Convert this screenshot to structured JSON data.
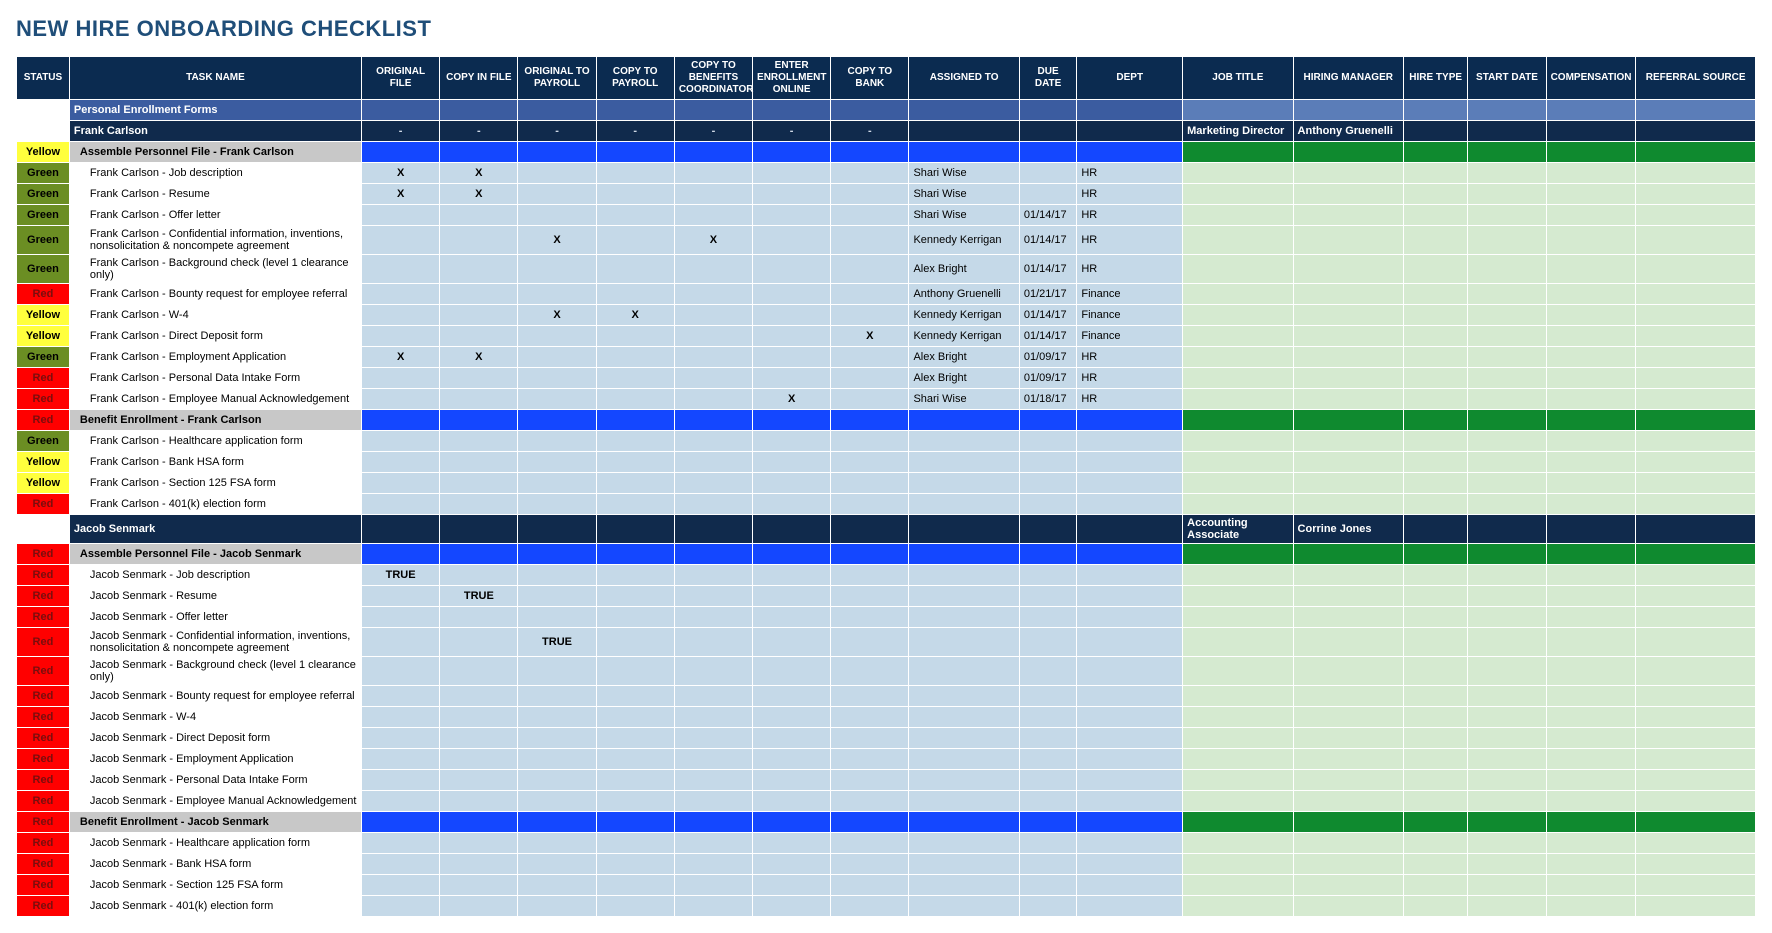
{
  "title": "NEW HIRE ONBOARDING CHECKLIST",
  "columns": [
    "STATUS",
    "TASK NAME",
    "ORIGINAL FILE",
    "COPY IN FILE",
    "ORIGINAL TO PAYROLL",
    "COPY TO PAYROLL",
    "COPY TO BENEFITS COORDINATOR",
    "ENTER ENROLLMENT ONLINE",
    "COPY TO BANK",
    "ASSIGNED TO",
    "DUE DATE",
    "DEPT",
    "JOB TITLE",
    "HIRING MANAGER",
    "HIRE TYPE",
    "START DATE",
    "COMPENSATION",
    "REFERRAL SOURCE"
  ],
  "status_labels": {
    "yellow": "Yellow",
    "green": "Green",
    "red": "Red"
  },
  "chart_data": {
    "type": "table",
    "title": "NEW HIRE ONBOARDING CHECKLIST",
    "rows": [
      {
        "type": "cat",
        "task": "Personal Enrollment Forms"
      },
      {
        "type": "person",
        "task": "Frank Carlson",
        "dashes": true,
        "job": "Marketing Director",
        "mgr": "Anthony Gruenelli"
      },
      {
        "type": "group",
        "status": "yellow",
        "task": "Assemble Personnel File - Frank Carlson"
      },
      {
        "type": "item",
        "status": "green",
        "task": "Frank Carlson - Job description",
        "c0": "X",
        "c1": "X",
        "assigned": "Shari Wise",
        "dept": "HR"
      },
      {
        "type": "item",
        "status": "green",
        "task": "Frank Carlson - Resume",
        "c0": "X",
        "c1": "X",
        "assigned": "Shari Wise",
        "dept": "HR"
      },
      {
        "type": "item",
        "status": "green",
        "task": "Frank Carlson - Offer letter",
        "assigned": "Shari Wise",
        "due": "01/14/17",
        "dept": "HR"
      },
      {
        "type": "item",
        "status": "green",
        "task": "Frank Carlson - Confidential information, inventions, nonsolicitation & noncompete agreement",
        "c2": "X",
        "c4": "X",
        "assigned": "Kennedy Kerrigan",
        "due": "01/14/17",
        "dept": "HR"
      },
      {
        "type": "item",
        "status": "green",
        "task": "Frank Carlson - Background check (level 1 clearance only)",
        "assigned": "Alex Bright",
        "due": "01/14/17",
        "dept": "HR"
      },
      {
        "type": "item",
        "status": "red",
        "task": "Frank Carlson - Bounty request for employee referral",
        "assigned": "Anthony Gruenelli",
        "due": "01/21/17",
        "dept": "Finance"
      },
      {
        "type": "item",
        "status": "yellow",
        "task": "Frank Carlson - W-4",
        "c2": "X",
        "c3": "X",
        "assigned": "Kennedy Kerrigan",
        "due": "01/14/17",
        "dept": "Finance"
      },
      {
        "type": "item",
        "status": "yellow",
        "task": "Frank Carlson - Direct Deposit form",
        "c6": "X",
        "assigned": "Kennedy Kerrigan",
        "due": "01/14/17",
        "dept": "Finance"
      },
      {
        "type": "item",
        "status": "green",
        "task": "Frank Carlson - Employment Application",
        "c0": "X",
        "c1": "X",
        "assigned": "Alex Bright",
        "due": "01/09/17",
        "dept": "HR"
      },
      {
        "type": "item",
        "status": "red",
        "task": "Frank Carlson - Personal Data Intake Form",
        "assigned": "Alex Bright",
        "due": "01/09/17",
        "dept": "HR"
      },
      {
        "type": "item",
        "status": "red",
        "task": "Frank Carlson - Employee Manual Acknowledgement",
        "c5": "X",
        "assigned": "Shari Wise",
        "due": "01/18/17",
        "dept": "HR"
      },
      {
        "type": "group",
        "status": "red",
        "task": "Benefit Enrollment - Frank Carlson"
      },
      {
        "type": "item",
        "status": "green",
        "task": "Frank Carlson - Healthcare application form"
      },
      {
        "type": "item",
        "status": "yellow",
        "task": "Frank Carlson - Bank HSA form"
      },
      {
        "type": "item",
        "status": "yellow",
        "task": "Frank Carlson - Section 125 FSA form"
      },
      {
        "type": "item",
        "status": "red",
        "task": "Frank Carlson - 401(k) election form"
      },
      {
        "type": "person",
        "task": "Jacob Senmark",
        "job": "Accounting Associate",
        "mgr": "Corrine Jones"
      },
      {
        "type": "group",
        "status": "red",
        "task": "Assemble Personnel File - Jacob Senmark"
      },
      {
        "type": "item",
        "status": "red",
        "task": "Jacob Senmark - Job description",
        "c0": "TRUE"
      },
      {
        "type": "item",
        "status": "red",
        "task": "Jacob Senmark - Resume",
        "c1": "TRUE"
      },
      {
        "type": "item",
        "status": "red",
        "task": "Jacob Senmark - Offer letter"
      },
      {
        "type": "item",
        "status": "red",
        "task": "Jacob Senmark - Confidential information, inventions, nonsolicitation & noncompete agreement",
        "c2": "TRUE"
      },
      {
        "type": "item",
        "status": "red",
        "task": "Jacob Senmark - Background check (level 1 clearance only)"
      },
      {
        "type": "item",
        "status": "red",
        "task": "Jacob Senmark - Bounty request for employee referral"
      },
      {
        "type": "item",
        "status": "red",
        "task": "Jacob Senmark - W-4"
      },
      {
        "type": "item",
        "status": "red",
        "task": "Jacob Senmark - Direct Deposit form"
      },
      {
        "type": "item",
        "status": "red",
        "task": "Jacob Senmark - Employment Application"
      },
      {
        "type": "item",
        "status": "red",
        "task": "Jacob Senmark - Personal Data Intake Form"
      },
      {
        "type": "item",
        "status": "red",
        "task": "Jacob Senmark - Employee Manual Acknowledgement"
      },
      {
        "type": "group",
        "status": "red",
        "task": "Benefit Enrollment - Jacob Senmark"
      },
      {
        "type": "item",
        "status": "red",
        "task": "Jacob Senmark - Healthcare application form"
      },
      {
        "type": "item",
        "status": "red",
        "task": "Jacob Senmark - Bank HSA form"
      },
      {
        "type": "item",
        "status": "red",
        "task": "Jacob Senmark - Section 125 FSA form"
      },
      {
        "type": "item",
        "status": "red",
        "task": "Jacob Senmark - 401(k) election form"
      }
    ]
  }
}
